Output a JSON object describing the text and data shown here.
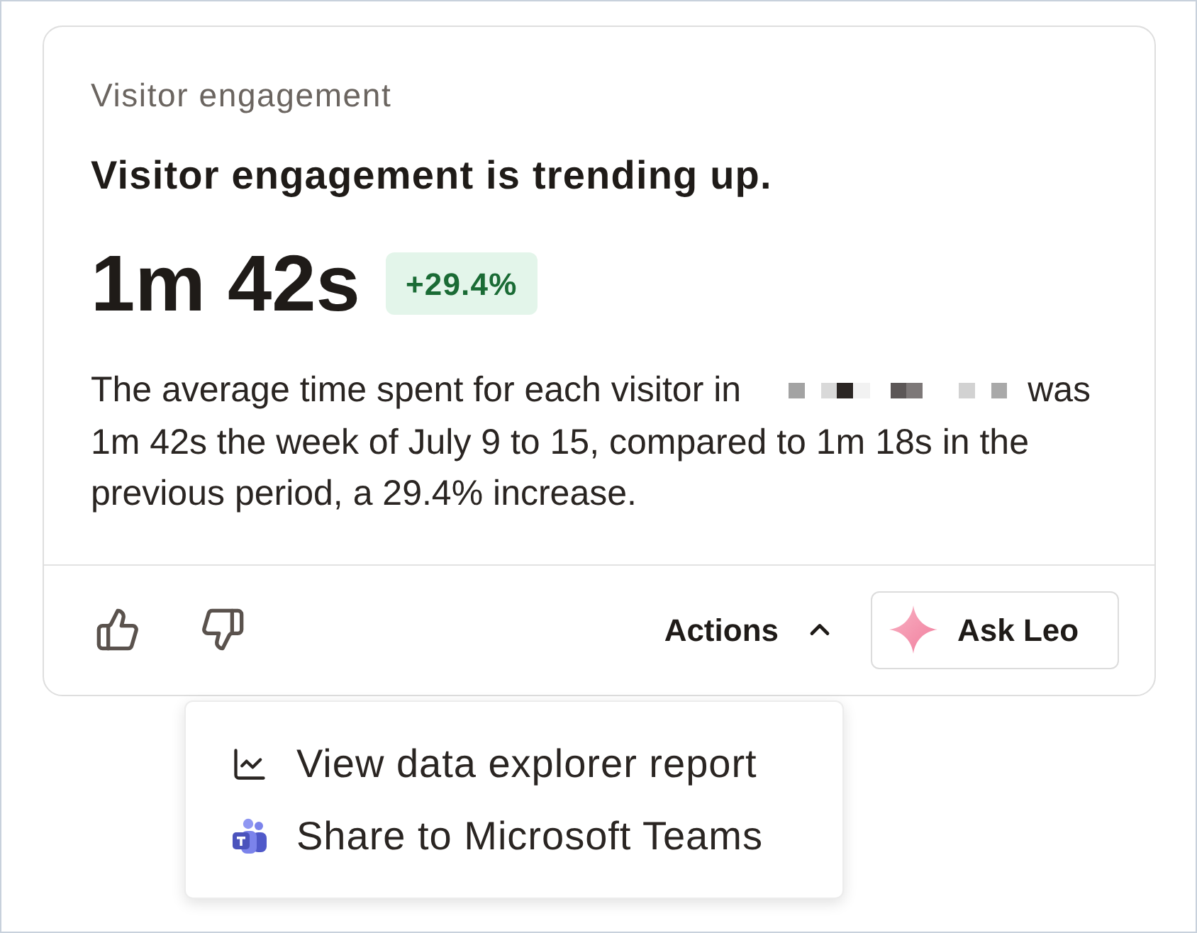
{
  "card": {
    "eyebrow": "Visitor engagement",
    "headline": "Visitor engagement is trending up.",
    "metric": {
      "value": "1m 42s",
      "change": "+29.4%",
      "positive": true
    },
    "summary": {
      "lead": "The average time spent for each visitor in",
      "after_redaction": "was",
      "rest": "1m 42s the week of July 9 to 15, compared to 1m 18s in the previous period, a 29.4% increase."
    },
    "feedback": [
      {
        "kind": "thumbs_up"
      },
      {
        "kind": "thumbs_down"
      }
    ],
    "actions": {
      "label": "Actions",
      "expanded": true
    },
    "ask_button": {
      "label": "Ask Leo"
    }
  },
  "menu": {
    "items": [
      {
        "kind": "chart",
        "label": "View data explorer report"
      },
      {
        "kind": "teams",
        "label": "Share to Microsoft Teams"
      }
    ]
  }
}
